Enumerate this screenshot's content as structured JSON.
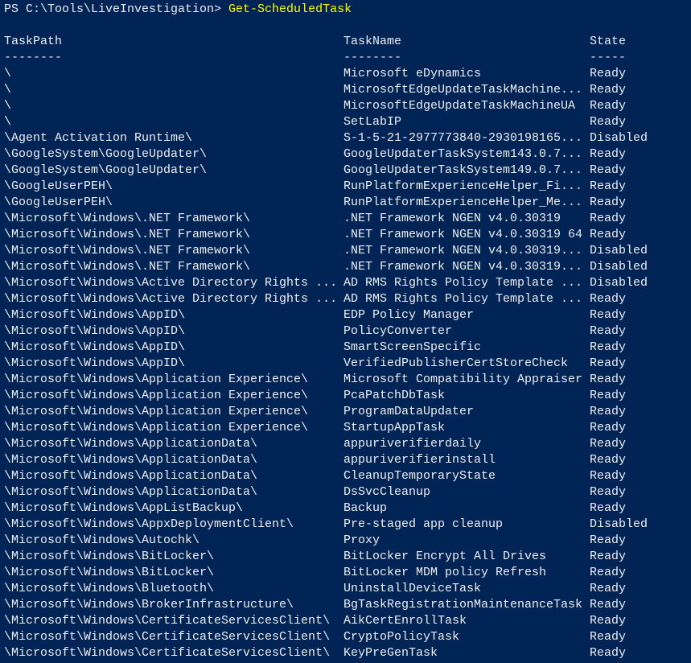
{
  "console": {
    "prompt": "PS C:\\Tools\\LiveInvestigation> ",
    "command": "Get-ScheduledTask",
    "accent_color": "#ffff00",
    "background_color": "#012456",
    "text_color": "#eeedf0"
  },
  "table": {
    "headers": [
      "TaskPath",
      "TaskName",
      "State"
    ],
    "separators": [
      "--------",
      "--------",
      "-----"
    ],
    "rows": [
      [
        "\\",
        "Microsoft eDynamics",
        "Ready"
      ],
      [
        "\\",
        "MicrosoftEdgeUpdateTaskMachine...",
        "Ready"
      ],
      [
        "\\",
        "MicrosoftEdgeUpdateTaskMachineUA",
        "Ready"
      ],
      [
        "\\",
        "SetLabIP",
        "Ready"
      ],
      [
        "\\Agent Activation Runtime\\",
        "S-1-5-21-2977773840-2930198165...",
        "Disabled"
      ],
      [
        "\\GoogleSystem\\GoogleUpdater\\",
        "GoogleUpdaterTaskSystem143.0.7...",
        "Ready"
      ],
      [
        "\\GoogleSystem\\GoogleUpdater\\",
        "GoogleUpdaterTaskSystem149.0.7...",
        "Ready"
      ],
      [
        "\\GoogleUserPEH\\",
        "RunPlatformExperienceHelper_Fi...",
        "Ready"
      ],
      [
        "\\GoogleUserPEH\\",
        "RunPlatformExperienceHelper_Me...",
        "Ready"
      ],
      [
        "\\Microsoft\\Windows\\.NET Framework\\",
        ".NET Framework NGEN v4.0.30319",
        "Ready"
      ],
      [
        "\\Microsoft\\Windows\\.NET Framework\\",
        ".NET Framework NGEN v4.0.30319 64",
        "Ready"
      ],
      [
        "\\Microsoft\\Windows\\.NET Framework\\",
        ".NET Framework NGEN v4.0.30319...",
        "Disabled"
      ],
      [
        "\\Microsoft\\Windows\\.NET Framework\\",
        ".NET Framework NGEN v4.0.30319...",
        "Disabled"
      ],
      [
        "\\Microsoft\\Windows\\Active Directory Rights ...",
        "AD RMS Rights Policy Template ...",
        "Disabled"
      ],
      [
        "\\Microsoft\\Windows\\Active Directory Rights ...",
        "AD RMS Rights Policy Template ...",
        "Ready"
      ],
      [
        "\\Microsoft\\Windows\\AppID\\",
        "EDP Policy Manager",
        "Ready"
      ],
      [
        "\\Microsoft\\Windows\\AppID\\",
        "PolicyConverter",
        "Ready"
      ],
      [
        "\\Microsoft\\Windows\\AppID\\",
        "SmartScreenSpecific",
        "Ready"
      ],
      [
        "\\Microsoft\\Windows\\AppID\\",
        "VerifiedPublisherCertStoreCheck",
        "Ready"
      ],
      [
        "\\Microsoft\\Windows\\Application Experience\\",
        "Microsoft Compatibility Appraiser",
        "Ready"
      ],
      [
        "\\Microsoft\\Windows\\Application Experience\\",
        "PcaPatchDbTask",
        "Ready"
      ],
      [
        "\\Microsoft\\Windows\\Application Experience\\",
        "ProgramDataUpdater",
        "Ready"
      ],
      [
        "\\Microsoft\\Windows\\Application Experience\\",
        "StartupAppTask",
        "Ready"
      ],
      [
        "\\Microsoft\\Windows\\ApplicationData\\",
        "appuriverifierdaily",
        "Ready"
      ],
      [
        "\\Microsoft\\Windows\\ApplicationData\\",
        "appuriverifierinstall",
        "Ready"
      ],
      [
        "\\Microsoft\\Windows\\ApplicationData\\",
        "CleanupTemporaryState",
        "Ready"
      ],
      [
        "\\Microsoft\\Windows\\ApplicationData\\",
        "DsSvcCleanup",
        "Ready"
      ],
      [
        "\\Microsoft\\Windows\\AppListBackup\\",
        "Backup",
        "Ready"
      ],
      [
        "\\Microsoft\\Windows\\AppxDeploymentClient\\",
        "Pre-staged app cleanup",
        "Disabled"
      ],
      [
        "\\Microsoft\\Windows\\Autochk\\",
        "Proxy",
        "Ready"
      ],
      [
        "\\Microsoft\\Windows\\BitLocker\\",
        "BitLocker Encrypt All Drives",
        "Ready"
      ],
      [
        "\\Microsoft\\Windows\\BitLocker\\",
        "BitLocker MDM policy Refresh",
        "Ready"
      ],
      [
        "\\Microsoft\\Windows\\Bluetooth\\",
        "UninstallDeviceTask",
        "Ready"
      ],
      [
        "\\Microsoft\\Windows\\BrokerInfrastructure\\",
        "BgTaskRegistrationMaintenanceTask",
        "Ready"
      ],
      [
        "\\Microsoft\\Windows\\CertificateServicesClient\\",
        "AikCertEnrollTask",
        "Ready"
      ],
      [
        "\\Microsoft\\Windows\\CertificateServicesClient\\",
        "CryptoPolicyTask",
        "Ready"
      ],
      [
        "\\Microsoft\\Windows\\CertificateServicesClient\\",
        "KeyPreGenTask",
        "Ready"
      ]
    ]
  }
}
